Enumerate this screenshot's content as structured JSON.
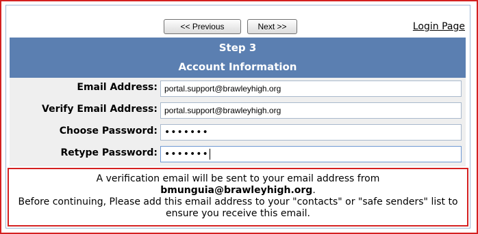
{
  "nav": {
    "previous_label": "<< Previous",
    "next_label": "Next >>",
    "login_label": "Login Page"
  },
  "header": {
    "step": "Step 3",
    "section": "Account Information"
  },
  "form": {
    "email_label": "Email Address:",
    "email_value": "portal.support@brawleyhigh.org",
    "verify_label": "Verify Email Address:",
    "verify_value": "portal.support@brawleyhigh.org",
    "password_label": "Choose Password:",
    "password_value": "•••••••",
    "retype_label": "Retype Password:",
    "retype_value": "•••••••"
  },
  "notice": {
    "line1": "A verification email will be sent to your email address from",
    "sender_email": "bmunguia@brawleyhigh.org",
    "sender_suffix": ".",
    "line2": "Before continuing, Please add this email address to your \"contacts\" or \"safe senders\" list to ensure you receive this email."
  },
  "colors": {
    "frame_border": "#d42020",
    "header_bg": "#5b7fb1",
    "rows_bg": "#efefef"
  }
}
